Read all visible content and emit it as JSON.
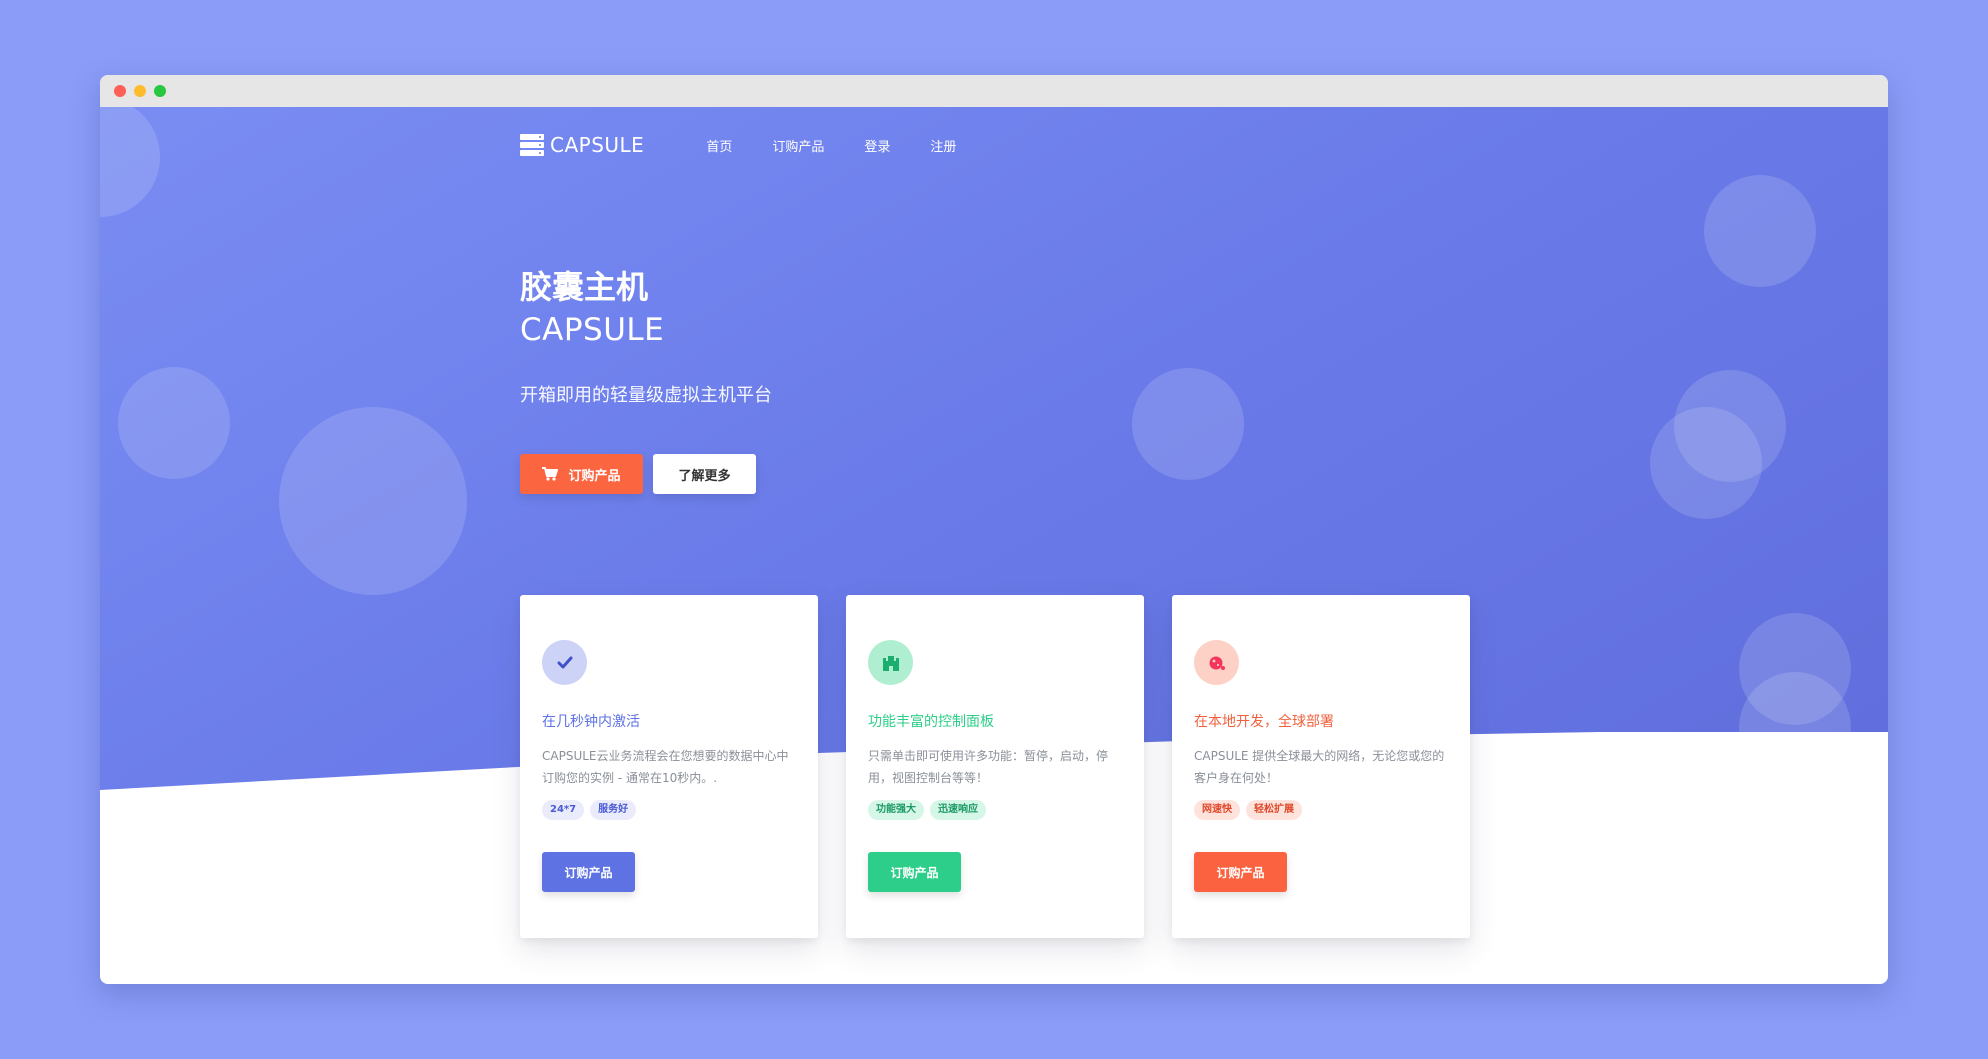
{
  "nav": {
    "logo_text": "CAPSULE",
    "links": [
      "首页",
      "订购产品",
      "登录",
      "注册"
    ]
  },
  "hero": {
    "title": "胶囊主机",
    "subtitle": "CAPSULE",
    "description": "开箱即用的轻量级虚拟主机平台",
    "primary_button": "订购产品",
    "secondary_button": "了解更多"
  },
  "cards": [
    {
      "icon": "check-icon",
      "title": "在几秒钟内激活",
      "text": "CAPSULE云业务流程会在您想要的数据中心中订购您的实例 - 通常在10秒内。.",
      "tags": [
        "24*7",
        "服务好"
      ],
      "button": "订购产品",
      "accent": "#5e72e4"
    },
    {
      "icon": "castle-icon",
      "title": "功能丰富的控制面板",
      "text": "只需单击即可使用许多功能：暂停，启动，停用，视图控制台等等！",
      "tags": [
        "功能强大",
        "迅速响应"
      ],
      "button": "订购产品",
      "accent": "#2dce89"
    },
    {
      "icon": "planet-icon",
      "title": "在本地开发，全球部署",
      "text": "CAPSULE 提供全球最大的网络，无论您或您的客户身在何处！",
      "tags": [
        "网速快",
        "轻松扩展"
      ],
      "button": "订购产品",
      "accent": "#fb6340"
    }
  ],
  "colors": {
    "page_background": "#8a9cf7",
    "hero_gradient_start": "#7a8df3",
    "hero_gradient_end": "#5d6bd9",
    "primary_button": "#fb6540"
  }
}
